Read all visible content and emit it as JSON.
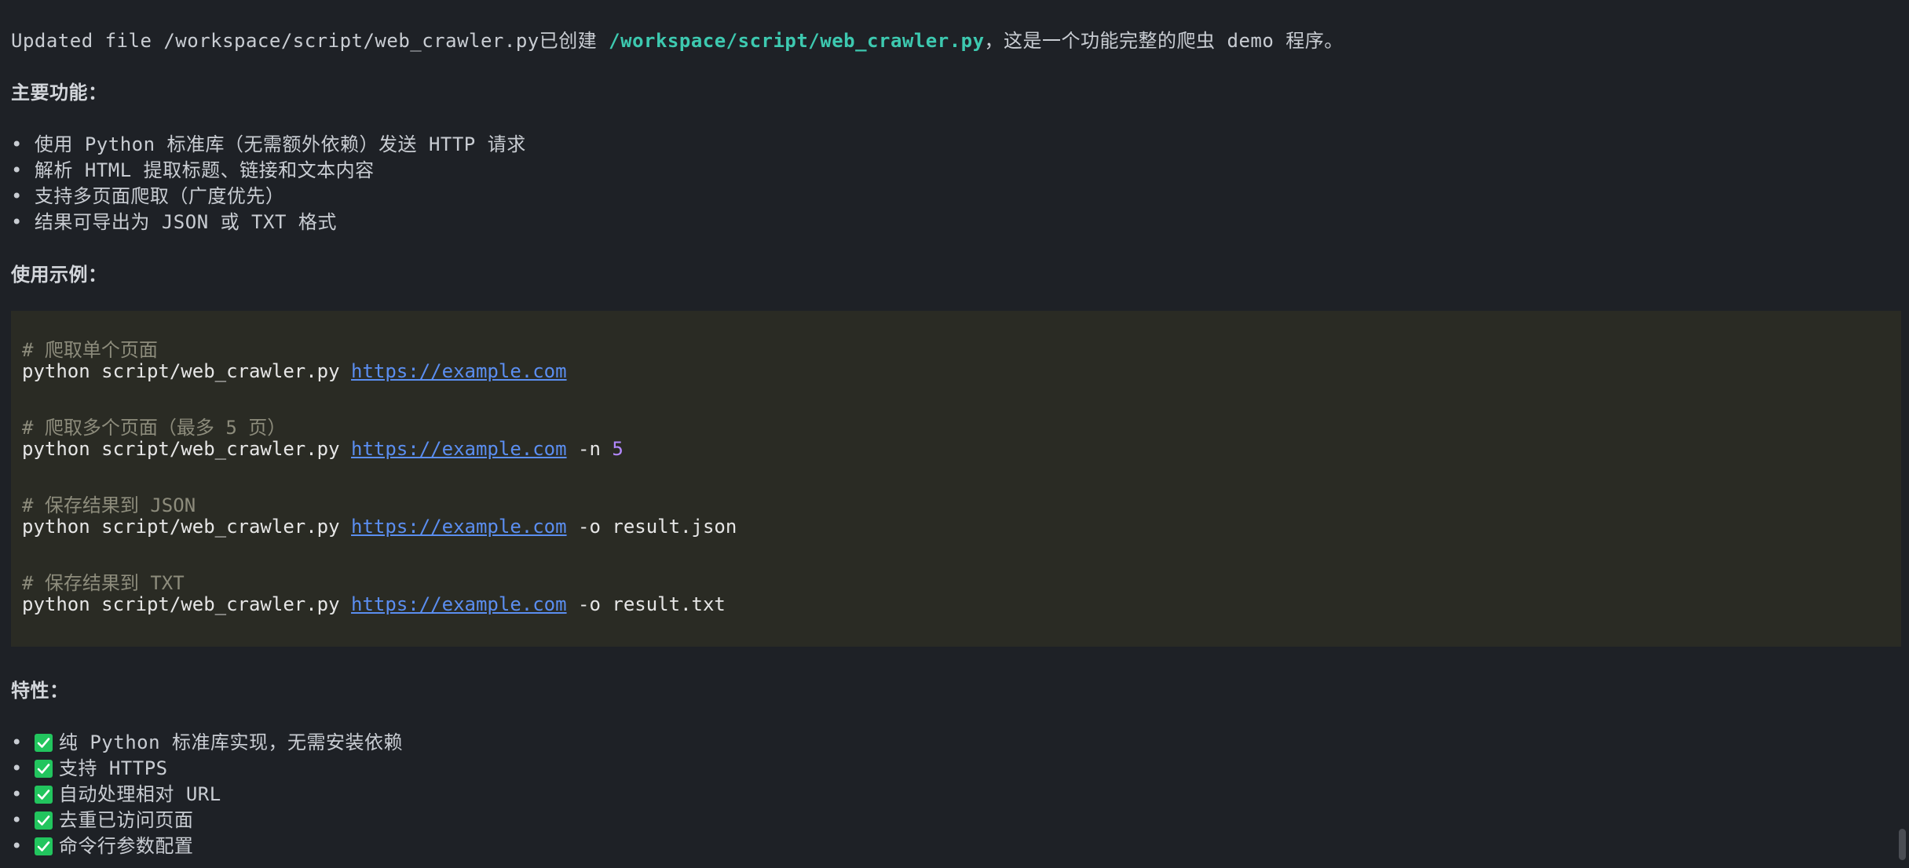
{
  "intro": {
    "prefix": "Updated file /workspace/script/web_crawler.py",
    "created": "已创建 ",
    "path": "/workspace/script/web_crawler.py",
    "suffix": "，这是一个功能完整的爬虫 demo 程序。"
  },
  "features_heading": "主要功能：",
  "features": [
    "使用 Python 标准库（无需额外依赖）发送 HTTP 请求",
    "解析 HTML 提取标题、链接和文本内容",
    "支持多页面爬取（广度优先）",
    "结果可导出为 JSON 或 TXT 格式"
  ],
  "usage_heading": "使用示例：",
  "code": {
    "examples": [
      {
        "comment": "# 爬取单个页面",
        "cmd": "python script/web_crawler.py ",
        "url": "https://example.com",
        "flag": "",
        "value": ""
      },
      {
        "comment": "# 爬取多个页面（最多 5 页）",
        "cmd": "python script/web_crawler.py ",
        "url": "https://example.com",
        "flag": " -n ",
        "value": "5"
      },
      {
        "comment": "# 保存结果到 JSON",
        "cmd": "python script/web_crawler.py ",
        "url": "https://example.com",
        "flag": " -o result.json",
        "value": ""
      },
      {
        "comment": "# 保存结果到 TXT",
        "cmd": "python script/web_crawler.py ",
        "url": "https://example.com",
        "flag": " -o result.txt",
        "value": ""
      }
    ]
  },
  "traits_heading": "特性：",
  "traits": [
    "纯 Python 标准库实现，无需安装依赖",
    "支持 HTTPS",
    "自动处理相对 URL",
    "去重已访问页面",
    "命令行参数配置"
  ],
  "colors": {
    "background": "#1e2126",
    "code_background": "#2a2b24",
    "path": "#3dc9b0",
    "url": "#5b8ef0",
    "number": "#b388ff",
    "check": "#22c55e"
  },
  "icons": {
    "trait_marker": "check-box-icon"
  }
}
